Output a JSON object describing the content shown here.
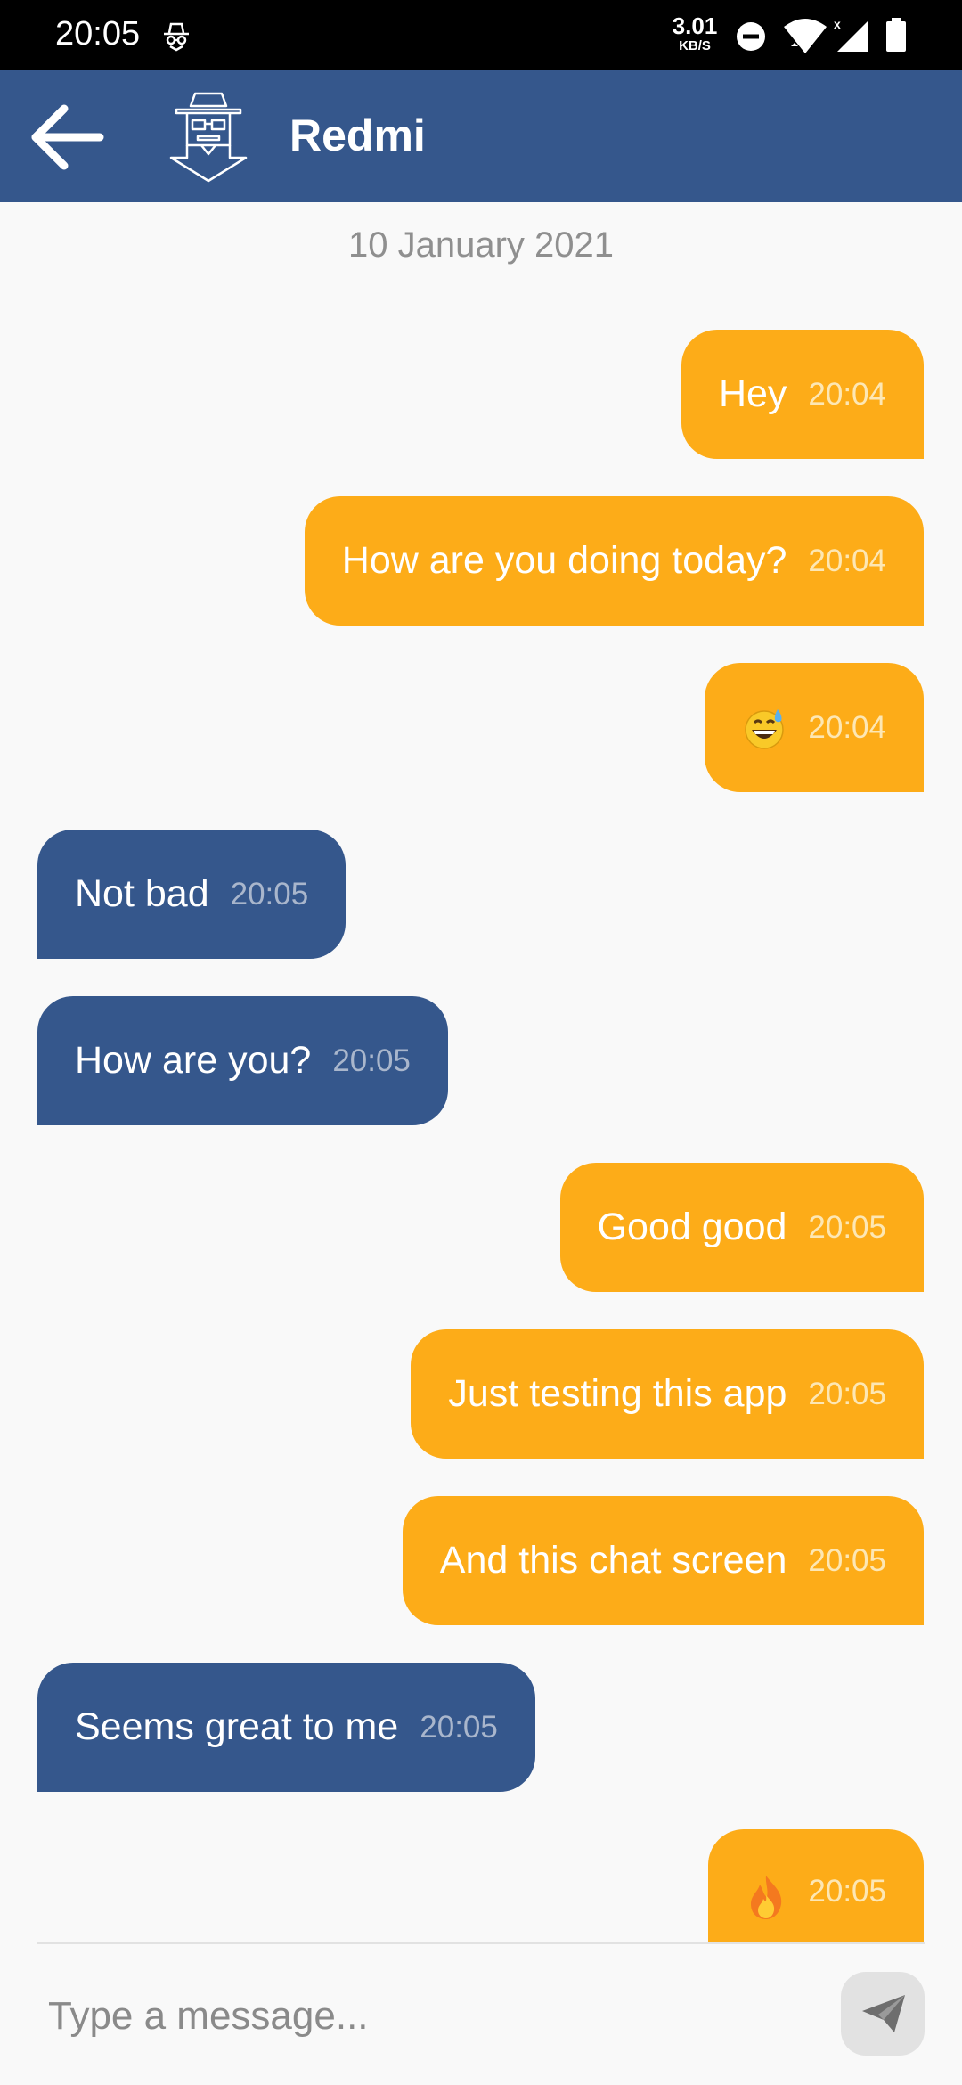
{
  "status_bar": {
    "time": "20:05",
    "net_speed_value": "3.01",
    "net_speed_unit": "KB/S",
    "icons": [
      "incognito-icon",
      "do-not-disturb-icon",
      "wifi-icon",
      "signal-icon",
      "battery-icon"
    ]
  },
  "header": {
    "contact_name": "Redmi",
    "back_icon": "arrow-left-icon",
    "avatar_icon": "spy-avatar-icon"
  },
  "date_separator": "10 January 2021",
  "messages": [
    {
      "direction": "sent",
      "text": "Hey",
      "time": "20:04"
    },
    {
      "direction": "sent",
      "text": "How are you doing today?",
      "time": "20:04"
    },
    {
      "direction": "sent",
      "emoji": "grinning-sweat-emoji",
      "time": "20:04"
    },
    {
      "direction": "received",
      "text": "Not bad",
      "time": "20:05"
    },
    {
      "direction": "received",
      "text": "How are you?",
      "time": "20:05"
    },
    {
      "direction": "sent",
      "text": "Good good",
      "time": "20:05"
    },
    {
      "direction": "sent",
      "text": "Just testing this app",
      "time": "20:05"
    },
    {
      "direction": "sent",
      "text": "And this chat screen",
      "time": "20:05"
    },
    {
      "direction": "received",
      "text": "Seems great to me",
      "time": "20:05"
    },
    {
      "direction": "sent",
      "emoji": "fire-emoji",
      "time": "20:05"
    }
  ],
  "composer": {
    "placeholder": "Type a message...",
    "value": "",
    "send_icon": "send-icon"
  },
  "colors": {
    "app_bar": "#35578c",
    "sent_bubble": "#fdac18",
    "received_bubble": "#35578c",
    "background": "#f9f9f9"
  }
}
